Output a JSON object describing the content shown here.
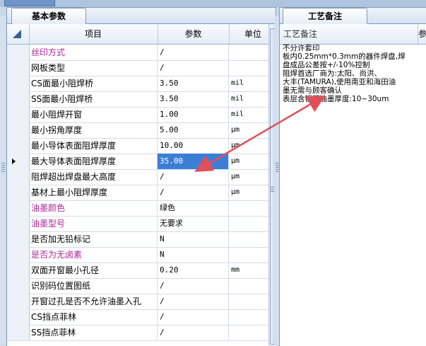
{
  "left_panel": {
    "tab_label": "基本参数",
    "columns": [
      "项目",
      "参数",
      "单位"
    ],
    "rows": [
      {
        "item": "丝印方式",
        "value": "/",
        "unit": "",
        "highlight": true
      },
      {
        "item": "网板类型",
        "value": "/",
        "unit": "",
        "highlight": false
      },
      {
        "item": "CS面最小阻焊桥",
        "value": "3.50",
        "unit": "mil",
        "highlight": false
      },
      {
        "item": "SS面最小阻焊桥",
        "value": "3.50",
        "unit": "mil",
        "highlight": false
      },
      {
        "item": "最小阻焊开窗",
        "value": "1.00",
        "unit": "mil",
        "highlight": false
      },
      {
        "item": "最小拐角厚度",
        "value": "5.00",
        "unit": "μm",
        "highlight": false
      },
      {
        "item": "最小导体表面阻焊厚度",
        "value": "10.00",
        "unit": "μm",
        "highlight": false
      },
      {
        "item": "最大导体表面阻焊厚度",
        "value": "35.00",
        "unit": "μm",
        "highlight": false,
        "selected": true
      },
      {
        "item": "阻焊超出焊盘最大高度",
        "value": "/",
        "unit": "μm",
        "highlight": false
      },
      {
        "item": "基材上最小阻焊厚度",
        "value": "/",
        "unit": "μm",
        "highlight": false
      },
      {
        "item": "油墨颜色",
        "value": "绿色",
        "unit": "",
        "highlight": true
      },
      {
        "item": "油墨型号",
        "value": "无要求",
        "unit": "",
        "highlight": true
      },
      {
        "item": "是否加无铅标记",
        "value": "N",
        "unit": "",
        "highlight": false
      },
      {
        "item": "是否为无卤素",
        "value": "N",
        "unit": "",
        "highlight": true
      },
      {
        "item": "双面开窗最小孔径",
        "value": "0.20",
        "unit": "mm",
        "highlight": false
      },
      {
        "item": "识别码位置图纸",
        "value": "/",
        "unit": "",
        "highlight": false
      },
      {
        "item": "开窗过孔是否不允许油墨入孔",
        "value": "/",
        "unit": "",
        "highlight": false
      },
      {
        "item": "CS挡点菲林",
        "value": "/",
        "unit": "",
        "highlight": false
      },
      {
        "item": "SS挡点菲林",
        "value": "/",
        "unit": "",
        "highlight": false
      }
    ]
  },
  "right_panel": {
    "tab_label": "工艺备注",
    "column": "工艺备注",
    "column2_fragment": "参",
    "memo_lines": [
      "不分许套印",
      "板内0.25mm*0.3mm的器件焊盘,焊",
      "盘成品公差按+/-10%控制",
      "阻焊首选厂商为:太阳、尚洪、",
      "大丰(TAMURA),使用南亚和海田油",
      "墨无需与顾客确认",
      "表层含铜区油墨厚度:10~30um"
    ]
  },
  "colors": {
    "highlight_text": "#b0259a",
    "selection": "#3c7ed6",
    "annotation_arrow": "#e0505a"
  }
}
